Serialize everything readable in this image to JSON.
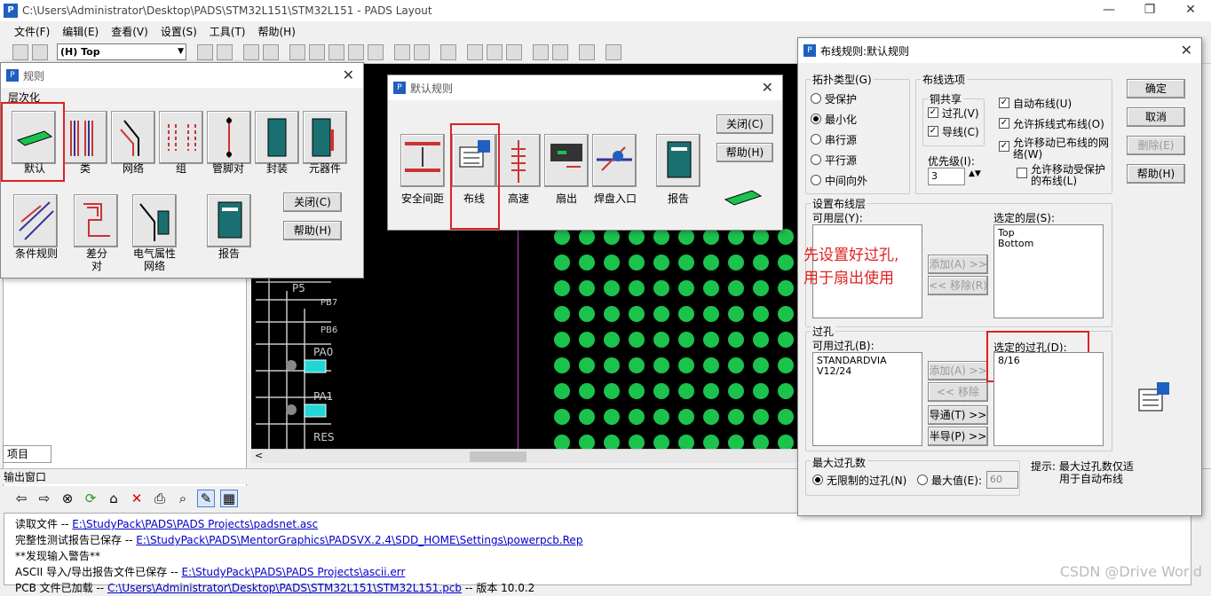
{
  "window": {
    "title": "C:\\Users\\Administrator\\Desktop\\PADS\\STM32L151\\STM32L151 - PADS Layout"
  },
  "menu": [
    "文件(F)",
    "编辑(E)",
    "查看(V)",
    "设置(S)",
    "工具(T)",
    "帮助(H)"
  ],
  "toolbar": {
    "layer": "(H) Top"
  },
  "rules_dialog": {
    "title": "规则",
    "section": "层次化",
    "tiles": [
      "默认",
      "类",
      "网络",
      "组",
      "管脚对",
      "封装",
      "元器件",
      "条件规则",
      "差分对",
      "电气属性网络",
      "报告"
    ],
    "diff_pair_label": [
      "差分",
      "对"
    ],
    "electrical_label": [
      "电气属性",
      "网络"
    ],
    "close": "关闭(C)",
    "help": "帮助(H)"
  },
  "default_rules_dialog": {
    "title": "默认规则",
    "tiles": [
      "安全间距",
      "布线",
      "高速",
      "扇出",
      "焊盘入口",
      "报告"
    ],
    "close": "关闭(C)",
    "help": "帮助(H)"
  },
  "routing_rules_dialog": {
    "title": "布线规则:默认规则",
    "topology_group": "拓扑类型(G)",
    "topology_options": [
      "受保护",
      "最小化",
      "串行源",
      "平行源",
      "中间向外"
    ],
    "routing_group": "布线选项",
    "copper_share": "铜共享",
    "via_check": "过孔(V)",
    "trace_check": "导线(C)",
    "auto_route": "自动布线(U)",
    "allow_ripup": "允许拆线式布线(O)",
    "allow_move_routed": "允许移动已布线的网络(W)",
    "allow_move_protected": "允许移动受保护的布线(L)",
    "priority_label": "优先级(I):",
    "priority_value": "3",
    "layer_group": "设置布线层",
    "available_layers": "可用层(Y):",
    "selected_layers": "选定的层(S):",
    "selected_layer_items": [
      "Top",
      "Bottom"
    ],
    "add_layer": "添加(A) >>",
    "remove_layer": "<< 移除(R)",
    "annotation": [
      "先设置好过孔,",
      "用于扇出使用"
    ],
    "via_group": "过孔",
    "available_vias": "可用过孔(B):",
    "available_via_items": [
      "STANDARDVIA",
      "V12/24"
    ],
    "selected_vias": "选定的过孔(D):",
    "selected_via_items": [
      "8/16"
    ],
    "add_via": "添加(A) >>",
    "remove_via": "<< 移除(M)",
    "through": "导通(T) >>",
    "half": "半导(P) >>",
    "max_via_group": "最大过孔数",
    "unlimited": "无限制的过孔(N)",
    "max_value": "最大值(E):",
    "max_value_num": "60",
    "hint": [
      "提示: 最大过孔数仅适",
      "用于自动布线"
    ],
    "ok": "确定",
    "cancel": "取消",
    "delete": "删除(E)",
    "help": "帮助(H)"
  },
  "left_panel": {
    "project_tab": "项目"
  },
  "pcb_labels": [
    "P5",
    "PB7",
    "PB6",
    "PA0",
    "PA1",
    "RES"
  ],
  "output": {
    "title": "输出窗口",
    "lines": [
      {
        "prefix": "读取文件  -- ",
        "link": "E:\\StudyPack\\PADS\\PADS Projects\\padsnet.asc",
        "suffix": ""
      },
      {
        "prefix": "完整性测试报告已保存  -- ",
        "link": "E:\\StudyPack\\PADS\\MentorGraphics\\PADSVX.2.4\\SDD_HOME\\Settings\\powerpcb.Rep",
        "suffix": ""
      },
      {
        "prefix": "**发现输入警告**",
        "link": "",
        "suffix": ""
      },
      {
        "prefix": "ASCII 导入/导出报告文件已保存  -- ",
        "link": "E:\\StudyPack\\PADS\\PADS Projects\\ascii.err",
        "suffix": ""
      },
      {
        "prefix": "PCB 文件已加载  -- ",
        "link": "C:\\Users\\Administrator\\Desktop\\PADS\\STM32L151\\STM32L151.pcb",
        "suffix": "  -- 版本 10.0.2"
      }
    ]
  },
  "watermark": "CSDN @Drive World",
  "colors": {
    "pcb_pad": "#1bc34d",
    "highlight": "#e02020",
    "link": "#0000cc"
  }
}
